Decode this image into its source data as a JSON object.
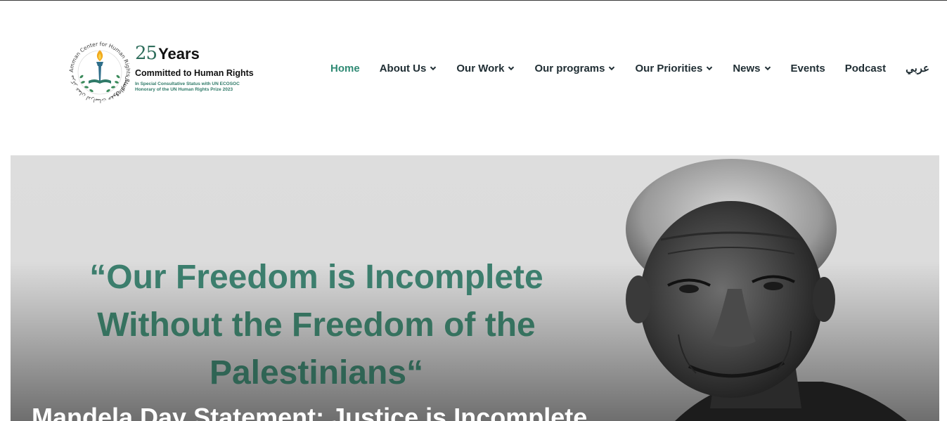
{
  "logo": {
    "years_number": "25",
    "years_word": "Years",
    "committed": "Committed to Human Rights",
    "status_line": "In Special Consultative Status with UN ECOSOC",
    "prize_line": "Honorary of the UN Human Rights Prize 2023",
    "ring_text_ar": "مركز عمان لدراسات حقوق الإنسان",
    "ring_text_en": "Amman Center for Human Rights Studies"
  },
  "nav": {
    "items": [
      {
        "label": "Home",
        "active": true,
        "dropdown": false
      },
      {
        "label": "About Us",
        "active": false,
        "dropdown": true
      },
      {
        "label": "Our Work",
        "active": false,
        "dropdown": true
      },
      {
        "label": "Our programs",
        "active": false,
        "dropdown": true
      },
      {
        "label": "Our Priorities",
        "active": false,
        "dropdown": true
      },
      {
        "label": "News",
        "active": false,
        "dropdown": true
      },
      {
        "label": "Events",
        "active": false,
        "dropdown": false
      },
      {
        "label": "Podcast",
        "active": false,
        "dropdown": false
      },
      {
        "label": "عربي",
        "active": false,
        "dropdown": false
      }
    ]
  },
  "hero": {
    "quote_lines": [
      "“Our Freedom is Incomplete",
      "Without the Freedom of the",
      "Palestinians“"
    ],
    "headline": "Mandela Day Statement: Justice is Incomplete"
  },
  "colors": {
    "accent": "#2f8a74",
    "quote": "#3c7e6d",
    "nav_text": "#1f2d33"
  },
  "icons": {
    "chevron": "chevron-down-icon",
    "emblem": "torch-laurel-emblem-icon"
  }
}
